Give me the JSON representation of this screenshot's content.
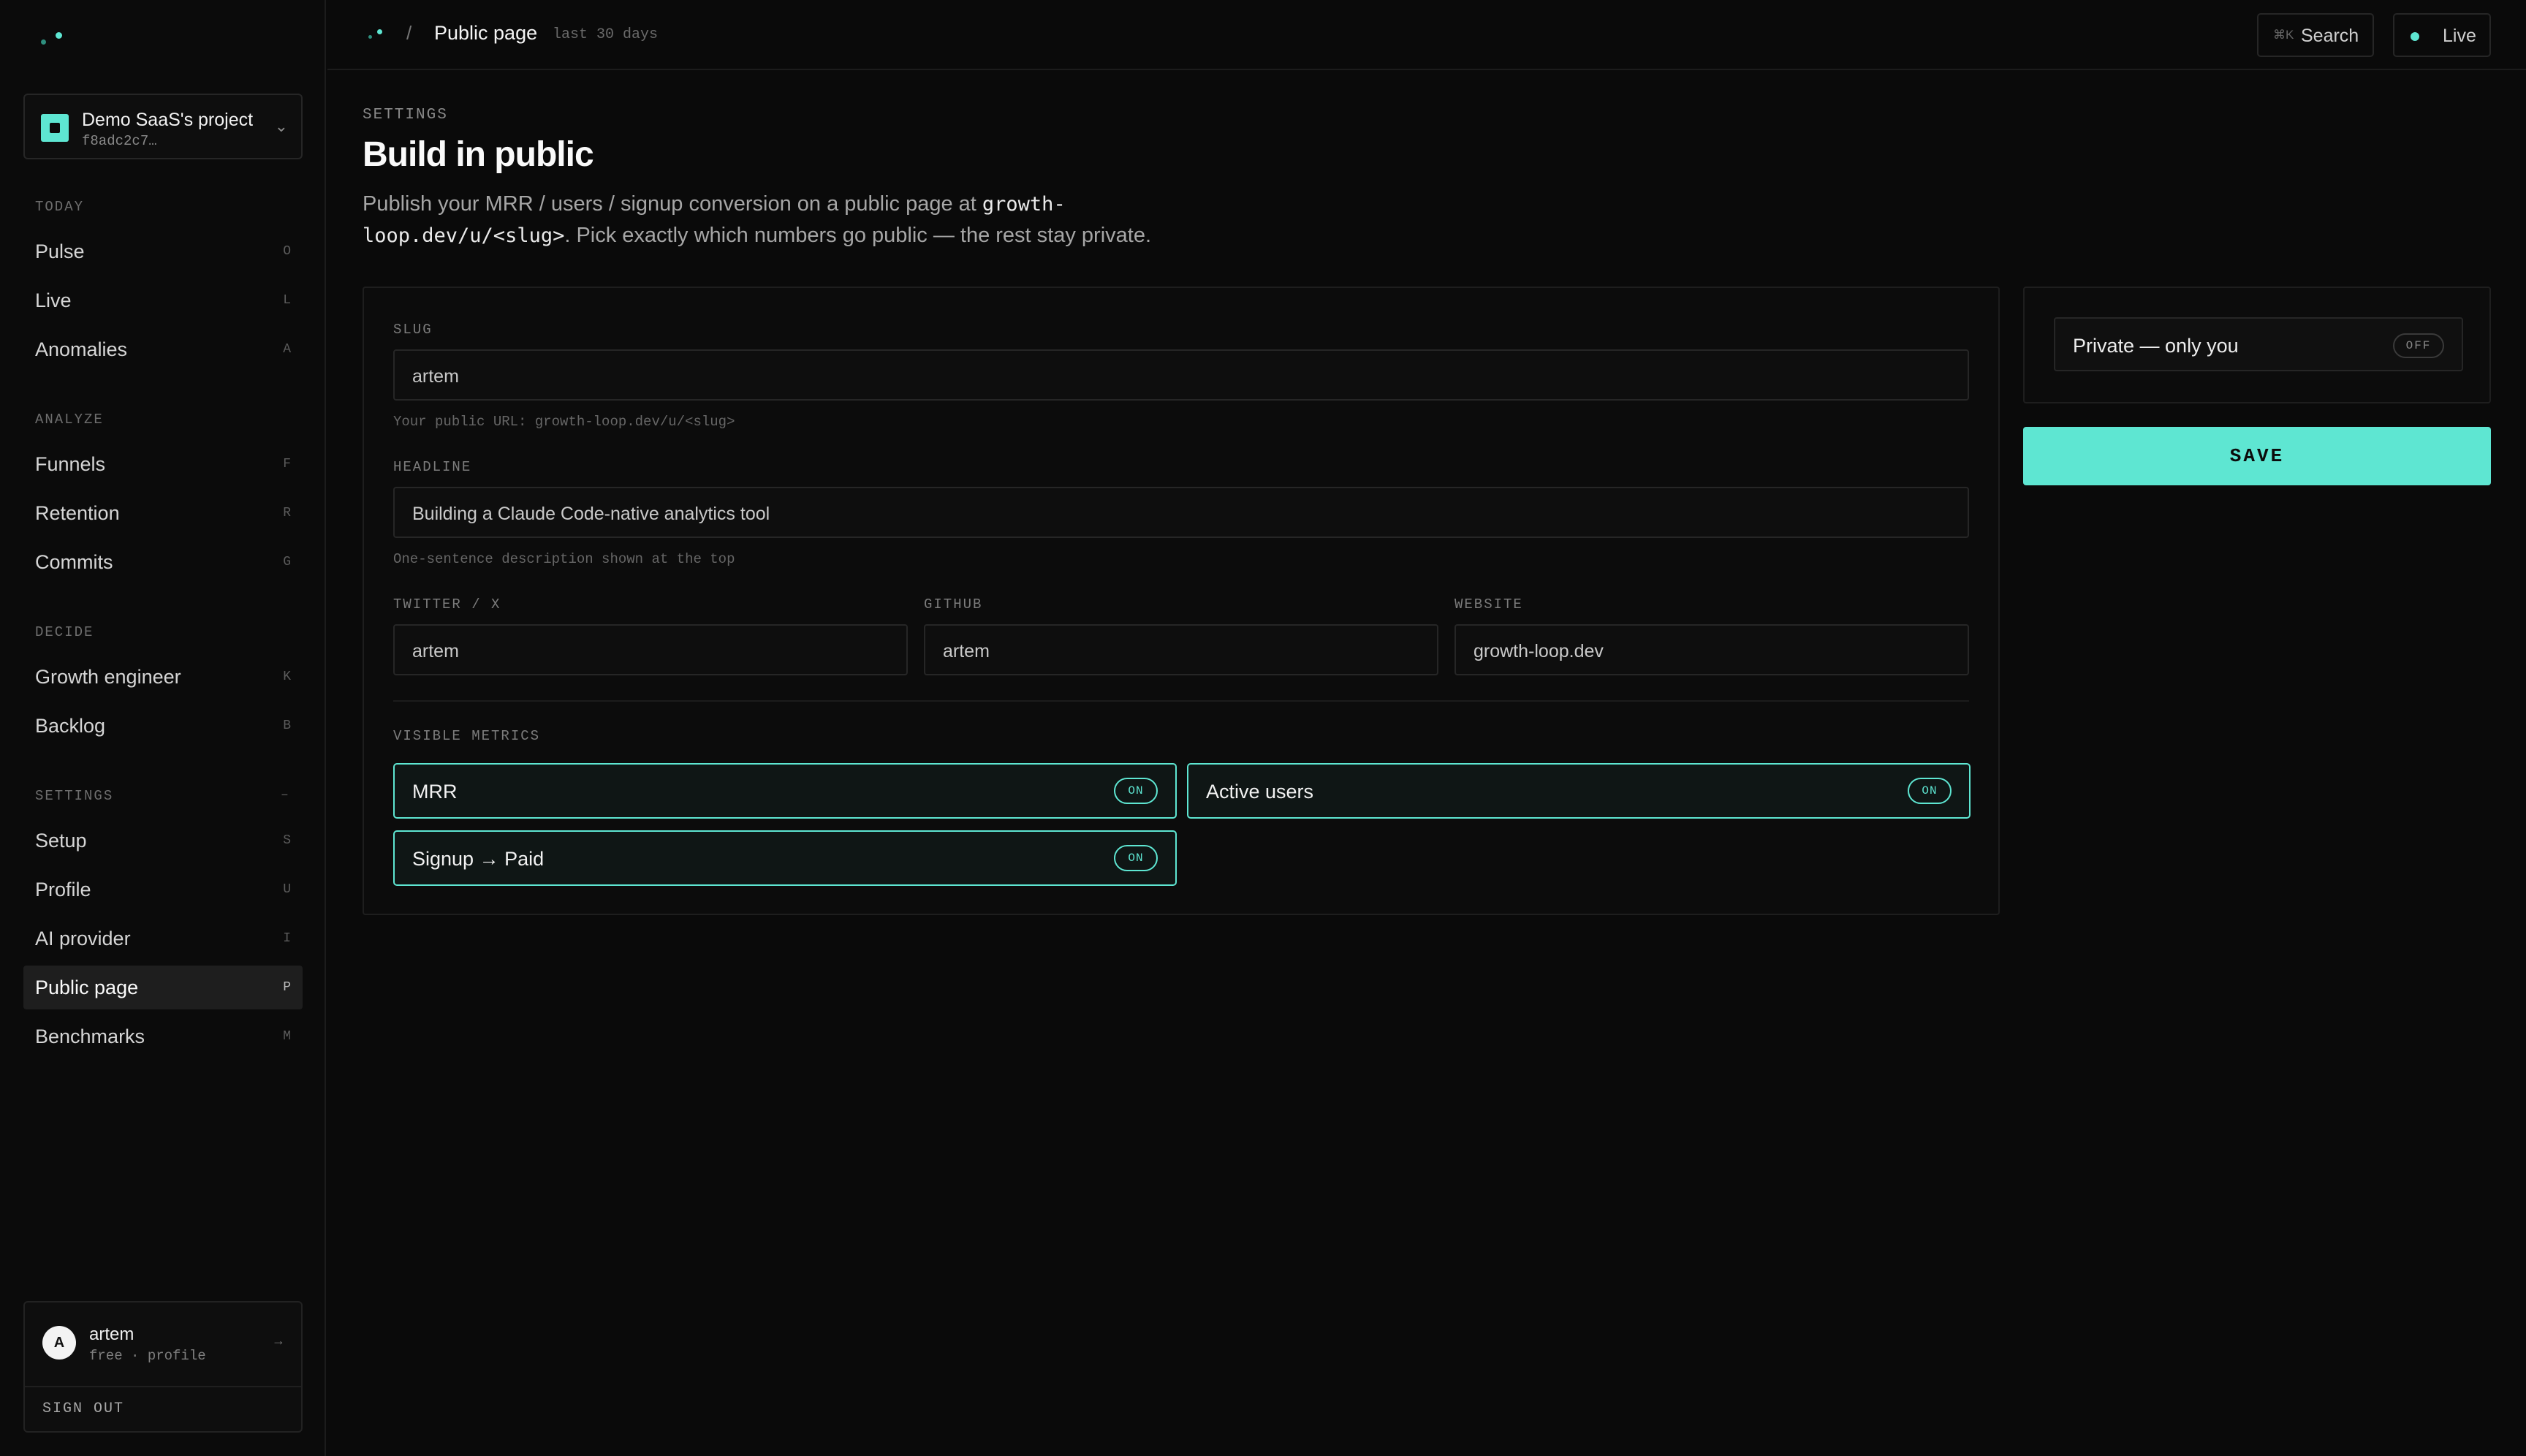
{
  "sidebar": {
    "project": {
      "name": "Demo SaaS's project",
      "id": "f8adc2c7…",
      "chevron_icon": "chevron-down-icon"
    },
    "sections": [
      {
        "label": "TODAY",
        "items": [
          {
            "label": "Pulse",
            "key": "O"
          },
          {
            "label": "Live",
            "key": "L"
          },
          {
            "label": "Anomalies",
            "key": "A"
          }
        ]
      },
      {
        "label": "ANALYZE",
        "items": [
          {
            "label": "Funnels",
            "key": "F"
          },
          {
            "label": "Retention",
            "key": "R"
          },
          {
            "label": "Commits",
            "key": "G"
          }
        ]
      },
      {
        "label": "DECIDE",
        "items": [
          {
            "label": "Growth engineer",
            "key": "K"
          },
          {
            "label": "Backlog",
            "key": "B"
          }
        ]
      },
      {
        "label": "SETTINGS",
        "key": "–",
        "items": [
          {
            "label": "Setup",
            "key": "S"
          },
          {
            "label": "Profile",
            "key": "U"
          },
          {
            "label": "AI provider",
            "key": "I"
          },
          {
            "label": "Public page",
            "key": "P",
            "active": true
          },
          {
            "label": "Benchmarks",
            "key": "M"
          }
        ]
      }
    ],
    "user": {
      "initial": "A",
      "name": "artem",
      "plan": "free · profile",
      "arrow": "→",
      "signout": "SIGN OUT"
    }
  },
  "topbar": {
    "separator": "/",
    "title": "Public page",
    "range": "last 30 days",
    "search": {
      "kbd": "⌘K",
      "label": "Search"
    },
    "live": {
      "label": "Live"
    }
  },
  "main": {
    "section_label": "SETTINGS",
    "title": "Build in public",
    "description_pre": "Publish your MRR / users / signup conversion on a public page at ",
    "description_code": "growth-loop.dev/u/<slug>",
    "description_post": ". Pick exactly which numbers go public — the rest stay private.",
    "form": {
      "slug": {
        "label": "SLUG",
        "value": "artem",
        "hint": "Your public URL: growth-loop.dev/u/<slug>"
      },
      "headline": {
        "label": "HEADLINE",
        "value": "Building a Claude Code-native analytics tool",
        "hint": "One-sentence description shown at the top"
      },
      "twitter": {
        "label": "TWITTER / X",
        "value": "artem"
      },
      "github": {
        "label": "GITHUB",
        "value": "artem"
      },
      "website": {
        "label": "WEBSITE",
        "value": "growth-loop.dev"
      },
      "metrics_label": "VISIBLE METRICS",
      "metrics": [
        {
          "name": "MRR",
          "state": "ON"
        },
        {
          "name": "Active users",
          "state": "ON"
        },
        {
          "name": "Signup → Paid",
          "state": "ON"
        }
      ]
    },
    "privacy": {
      "label": "Private — only you",
      "state": "OFF"
    },
    "save_label": "SAVE"
  },
  "colors": {
    "accent": "#5ee6d2",
    "background": "#0a0a0a",
    "panel": "#0c0c0c",
    "border": "#262626"
  }
}
